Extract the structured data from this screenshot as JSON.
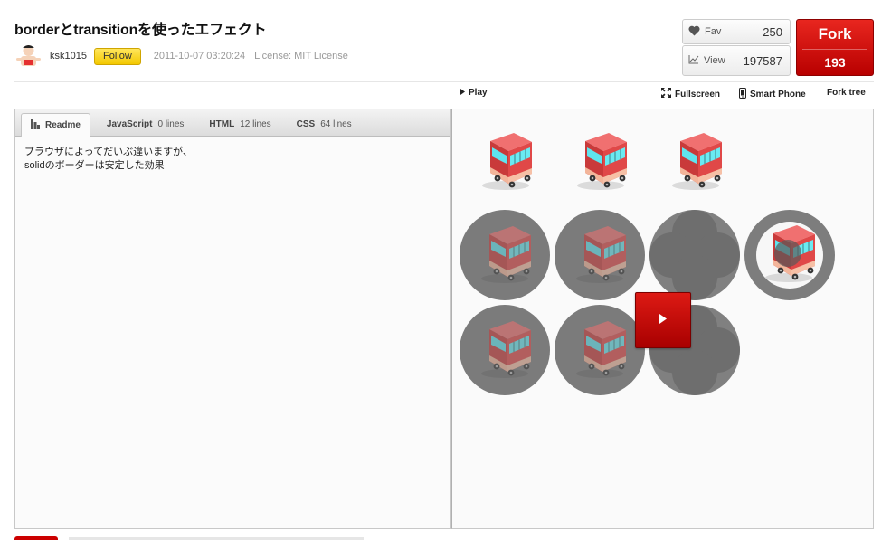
{
  "page": {
    "title": "borderとtransitionを使ったエフェクト"
  },
  "author": {
    "username": "ksk1015",
    "follow_label": "Follow",
    "date": "2011-10-07 03:20:24",
    "license": "License: MIT License"
  },
  "stats": {
    "fav_label": "Fav",
    "fav_count": "250",
    "view_label": "View",
    "view_count": "197587"
  },
  "fork": {
    "label": "Fork",
    "count": "193"
  },
  "toolbar": {
    "play": "Play",
    "fullscreen": "Fullscreen",
    "smartphone": "Smart Phone",
    "fork_tree": "Fork tree"
  },
  "tabs": [
    {
      "label": "Readme",
      "count": ""
    },
    {
      "label": "JavaScript",
      "count": "0 lines"
    },
    {
      "label": "HTML",
      "count": "12 lines"
    },
    {
      "label": "CSS",
      "count": "64 lines"
    }
  ],
  "readme": {
    "line1": "ブラウザによってだいぶ違いますが、",
    "line2": "solidのボーダーは安定した効果"
  },
  "colors": {
    "fork_red": "#c40a06",
    "follow_yellow": "#f5d000",
    "circle_gray": "#7b7b7b",
    "bus_red": "#e14a4a",
    "bus_window": "#5ee6f0"
  }
}
